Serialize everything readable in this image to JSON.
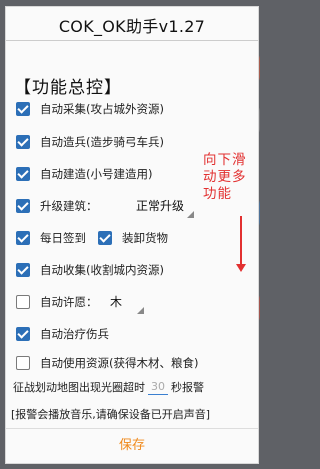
{
  "dialog": {
    "title": "COK_OK助手v1.27",
    "section_title": "【功能总控】"
  },
  "options": [
    {
      "label": "自动采集(攻占城外资源)",
      "checked": true
    },
    {
      "label": "自动造兵(造步骑弓车兵)",
      "checked": true
    },
    {
      "label": "自动建造(小号建造用)",
      "checked": true
    },
    {
      "label": "升级建筑：",
      "checked": true
    },
    {
      "label": "每日签到",
      "checked": true
    },
    {
      "label": "装卸货物",
      "checked": true
    },
    {
      "label": "自动收集(收割城内资源)",
      "checked": true
    },
    {
      "label": "自动许愿：",
      "checked": false
    },
    {
      "label": "自动治疗伤兵",
      "checked": true
    },
    {
      "label": "自动使用资源(获得木材、粮食)",
      "checked": false
    }
  ],
  "upgrade_mode": "正常升级",
  "wish_resource": "木",
  "hint_text": "向下滑动更多功能",
  "alert": {
    "prefix": "征战划动地图出现光圈超时",
    "value": "30",
    "suffix": "秒报警"
  },
  "notice": "[报警会播放音乐,请确保设备已开启声音]",
  "save_label": "保存",
  "colors": {
    "accent_blue": "#2c6fb7",
    "hint_red": "#e23030",
    "save_orange": "#f08a1c"
  }
}
